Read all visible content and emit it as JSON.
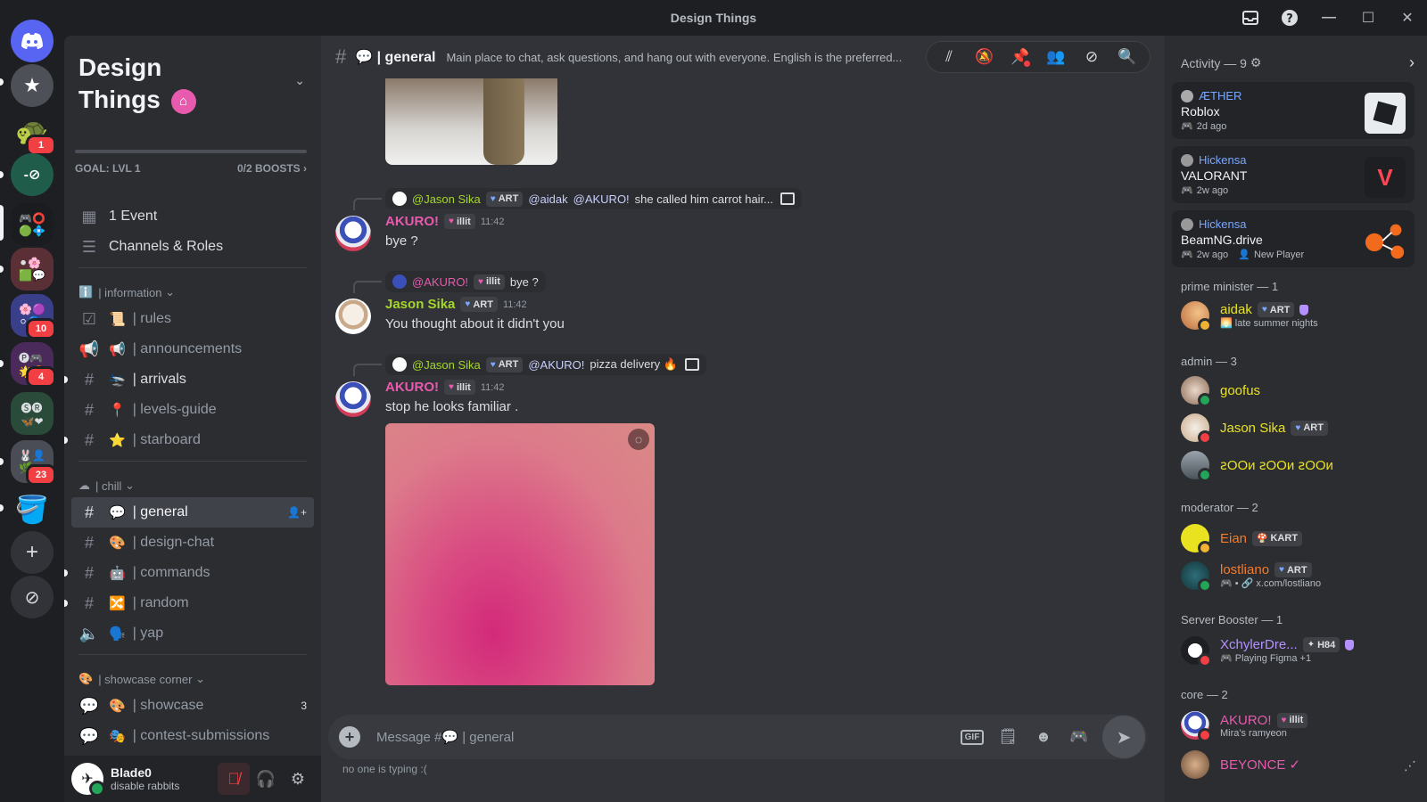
{
  "window": {
    "title": "Design Things"
  },
  "server": {
    "name": "Design Things",
    "goal_label": "GOAL: LVL 1",
    "boosts_label": "0/2 BOOSTS",
    "quick_items": [
      {
        "label": "1 Event",
        "icon": "calendar-icon"
      },
      {
        "label": "Channels & Roles",
        "icon": "channels-browse-icon"
      }
    ],
    "categories": [
      {
        "label": "| information",
        "emoji": "ℹ️",
        "channels": [
          {
            "label": "| rules",
            "emoji": "📜",
            "icon": "rules-checkbox-icon"
          },
          {
            "label": "| announcements",
            "emoji": "📢",
            "icon": "megaphone-icon"
          },
          {
            "label": "| arrivals",
            "emoji": "🛬",
            "icon": "hash-icon"
          },
          {
            "label": "| levels-guide",
            "emoji": "📍",
            "icon": "hash-icon"
          },
          {
            "label": "| starboard",
            "emoji": "⭐",
            "icon": "hash-icon"
          }
        ]
      },
      {
        "label": "| chill",
        "emoji": "☁",
        "channels": [
          {
            "label": "| general",
            "emoji": "💬",
            "icon": "hash-icon"
          },
          {
            "label": "| design-chat",
            "emoji": "🎨",
            "icon": "hash-icon"
          },
          {
            "label": "| commands",
            "emoji": "🤖",
            "icon": "hash-icon"
          },
          {
            "label": "| random",
            "emoji": "🔀",
            "icon": "hash-icon"
          },
          {
            "label": "| yap",
            "emoji": "🗣️",
            "icon": "speaker-icon"
          }
        ]
      },
      {
        "label": "| showcase corner",
        "emoji": "🎨",
        "channels": [
          {
            "label": "| showcase",
            "emoji": "🎨",
            "icon": "forum-icon",
            "count": "3"
          },
          {
            "label": "| contest-submissions",
            "emoji": "🎭",
            "icon": "forum-icon"
          }
        ]
      }
    ]
  },
  "rail": {
    "badges": [
      "1",
      "10",
      "4",
      "23"
    ]
  },
  "user": {
    "name": "Blade0",
    "status": "disable rabbits"
  },
  "channel": {
    "name": "| general",
    "emoji": "💬",
    "topic": "Main place to chat, ask questions, and hang out with everyone. English is the preferred...",
    "composer_placeholder": "Message #💬 | general",
    "typing": "no one is typing :("
  },
  "messages": [
    {
      "reply_user": "@Jason Sika",
      "reply_tag": "ART",
      "reply_text_mentions": [
        "@aidak",
        "@AKURO!"
      ],
      "reply_text": "she called him carrot hair...",
      "author": "AKURO!",
      "author_tag": "illit",
      "time": "11:42",
      "text": "bye ?"
    },
    {
      "reply_user": "@AKURO!",
      "reply_tag": "illit",
      "reply_text": "bye ?",
      "author": "Jason Sika",
      "author_tag": "ART",
      "time": "11:42",
      "text": "You thought about it didn't you"
    },
    {
      "reply_user": "@Jason Sika",
      "reply_tag": "ART",
      "reply_text_mentions": [
        "@AKURO!"
      ],
      "reply_text": "pizza delivery 🔥",
      "author": "AKURO!",
      "author_tag": "illit",
      "time": "11:42",
      "text": "stop he looks familiar ."
    }
  ],
  "activity": {
    "title": "Activity — 9",
    "cards": [
      {
        "user": "ÆTHER",
        "game": "Roblox",
        "ago": "2d ago",
        "extra": ""
      },
      {
        "user": "Hickensa",
        "game": "VALORANT",
        "ago": "2w ago",
        "extra": ""
      },
      {
        "user": "Hickensa",
        "game": "BeamNG.drive",
        "ago": "2w ago",
        "extra": "New Player"
      }
    ]
  },
  "roles": [
    {
      "title": "prime minister — 1",
      "members": [
        {
          "name": "aidak",
          "tag": "ART",
          "sub": "🌅 late summer nights"
        }
      ]
    },
    {
      "title": "admin — 3",
      "members": [
        {
          "name": "goofus"
        },
        {
          "name": "Jason Sika",
          "tag": "ART"
        },
        {
          "name": "ꙅOOᴎ ꙅOOᴎ ꙅOOᴎ"
        }
      ]
    },
    {
      "title": "moderator — 2",
      "members": [
        {
          "name": "Eian",
          "tag": "KART"
        },
        {
          "name": "lostliano",
          "tag": "ART",
          "sub": "🎮 • 🔗 x.com/lostliano"
        }
      ]
    },
    {
      "title": "Server Booster — 1",
      "members": [
        {
          "name": "XchylerDre...",
          "tag": "H84",
          "sub": "Playing Figma +1"
        }
      ]
    },
    {
      "title": "core — 2",
      "members": [
        {
          "name": "AKURO!",
          "tag": "illit",
          "sub": "Mira's ramyeon"
        },
        {
          "name": "BEYONCE ✓"
        }
      ]
    }
  ],
  "colors": {
    "pink_name": "#e75aad",
    "green_name": "#a6d62b",
    "orange_name": "#f47b2a",
    "blurple_link": "#7aa7ff"
  }
}
